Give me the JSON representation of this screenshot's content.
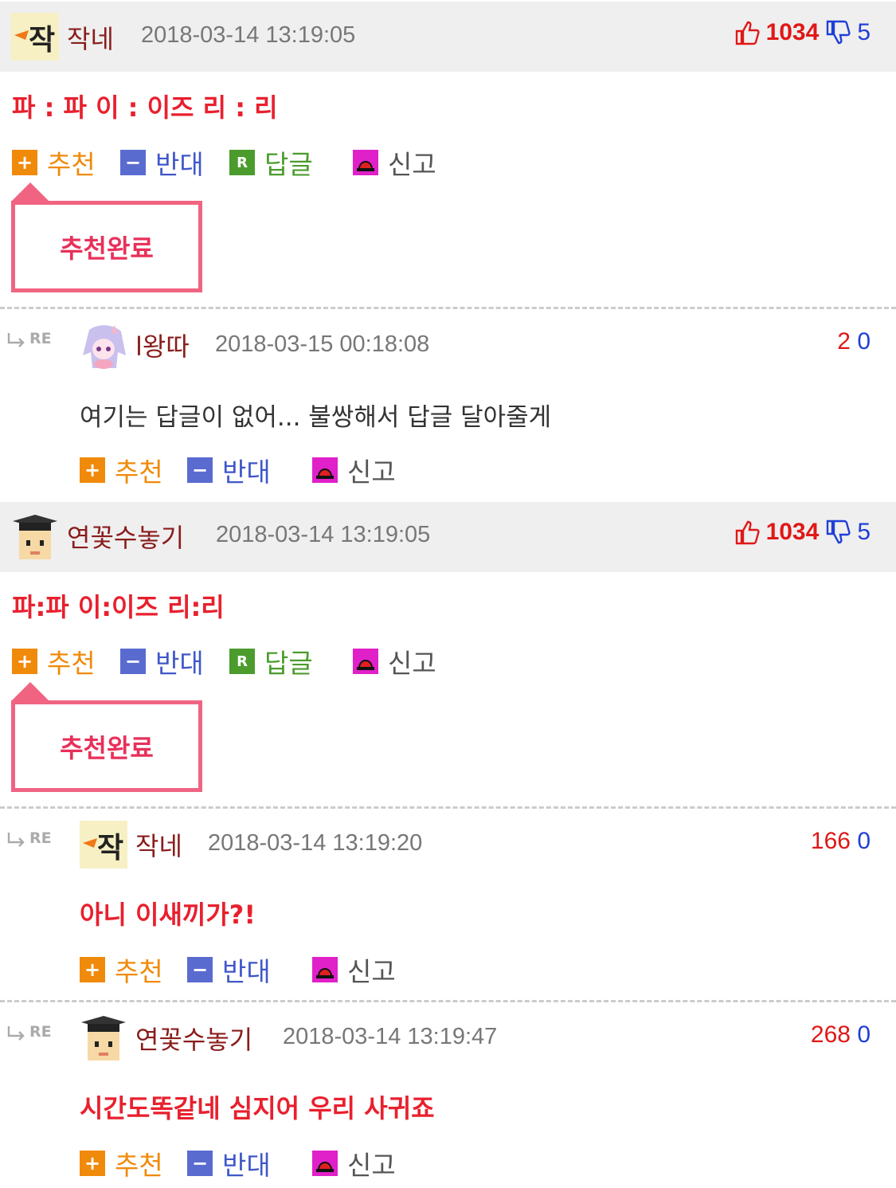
{
  "comments": [
    {
      "nick": "작네",
      "date": "2018-03-14 13:19:05",
      "up": "1034",
      "down": "5",
      "body": "파 : 파 이 : 이즈 리 : 리",
      "popup": "추천완료"
    },
    {
      "nick": "l왕따",
      "date": "2018-03-15 00:18:08",
      "up": "2",
      "down": "0",
      "body": "여기는 답글이 없어... 불쌍해서 답글 달아줄게"
    },
    {
      "nick": "연꽃수놓기",
      "date": "2018-03-14 13:19:05",
      "up": "1034",
      "down": "5",
      "body": "파:파 이:이즈 리:리",
      "popup": "추천완료"
    },
    {
      "nick": "작네",
      "date": "2018-03-14 13:19:20",
      "up": "166",
      "down": "0",
      "body": "아니 이새끼가?!"
    },
    {
      "nick": "연꽃수놓기",
      "date": "2018-03-14 13:19:47",
      "up": "268",
      "down": "0",
      "body": "시간도똑같네 심지어 우리 사귀죠"
    }
  ],
  "actions": {
    "recommend": "추천",
    "oppose": "반대",
    "reply": "답글",
    "report": "신고"
  },
  "icons": {
    "plus": "+",
    "minus": "−",
    "reply": "R",
    "re_label": "RE",
    "avatar_char": "작"
  },
  "colors": {
    "up": "#e01818",
    "down": "#1f3fd6",
    "best_bg": "#efefef",
    "popup_border": "#f06482"
  }
}
